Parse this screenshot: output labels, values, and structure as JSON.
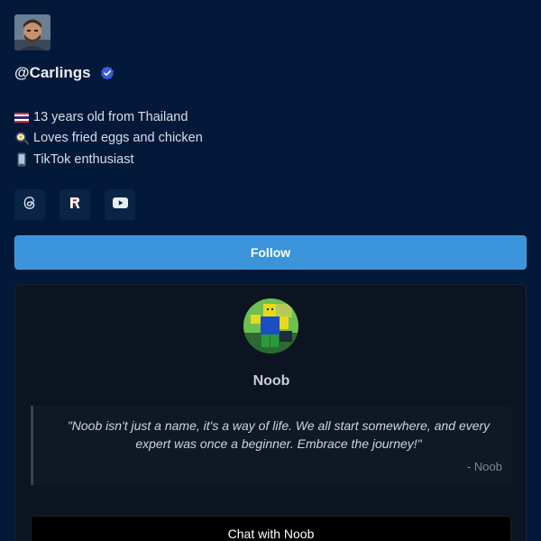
{
  "profile": {
    "username": "@Carlings",
    "verified": true,
    "avatar_icon": "profile-photo"
  },
  "bio": [
    {
      "emoji": "thailand-flag-icon",
      "text": "13 years old from Thailand"
    },
    {
      "emoji": "fried-egg-icon",
      "text": "Loves fried eggs and chicken"
    },
    {
      "emoji": "mobile-phone-icon",
      "text": "TikTok enthusiast"
    }
  ],
  "socials": [
    {
      "icon": "threads-icon"
    },
    {
      "icon": "roblox-icon"
    },
    {
      "icon": "youtube-icon"
    }
  ],
  "follow_label": "Follow",
  "bot": {
    "name": "Noob",
    "quote": "\"Noob isn't just a name, it's a way of life. We all start somewhere, and every expert was once a beginner. Embrace the journey!\"",
    "quote_author": "- Noob",
    "chat_label": "Chat with Noob"
  },
  "colors": {
    "background": "#03193a",
    "accent": "#3b94d9",
    "card": "#0b1420",
    "verified": "#3b5bdb"
  }
}
